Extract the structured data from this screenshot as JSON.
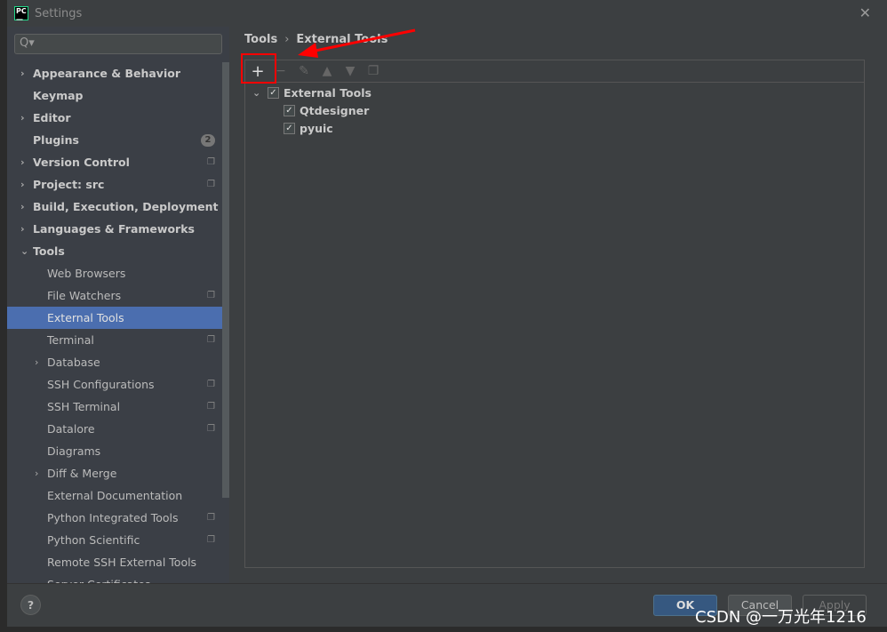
{
  "window": {
    "title": "Settings",
    "logo": "PC"
  },
  "search": {
    "placeholder": "Q▾"
  },
  "sidebar": {
    "items": [
      {
        "label": "Appearance & Behavior",
        "level": 0,
        "arrow": "›",
        "bold": true
      },
      {
        "label": "Keymap",
        "level": 0,
        "bold": true
      },
      {
        "label": "Editor",
        "level": 0,
        "arrow": "›",
        "bold": true
      },
      {
        "label": "Plugins",
        "level": 0,
        "bold": true,
        "badge": "2"
      },
      {
        "label": "Version Control",
        "level": 0,
        "arrow": "›",
        "bold": true,
        "copy": true
      },
      {
        "label": "Project: src",
        "level": 0,
        "arrow": "›",
        "bold": true,
        "copy": true
      },
      {
        "label": "Build, Execution, Deployment",
        "level": 0,
        "arrow": "›",
        "bold": true
      },
      {
        "label": "Languages & Frameworks",
        "level": 0,
        "arrow": "›",
        "bold": true
      },
      {
        "label": "Tools",
        "level": 0,
        "arrow": "⌄",
        "bold": true
      },
      {
        "label": "Web Browsers",
        "level": 1
      },
      {
        "label": "File Watchers",
        "level": 1,
        "copy": true
      },
      {
        "label": "External Tools",
        "level": 1,
        "selected": true
      },
      {
        "label": "Terminal",
        "level": 1,
        "copy": true
      },
      {
        "label": "Database",
        "level": 1,
        "arrow": "›"
      },
      {
        "label": "SSH Configurations",
        "level": 1,
        "copy": true
      },
      {
        "label": "SSH Terminal",
        "level": 1,
        "copy": true
      },
      {
        "label": "Datalore",
        "level": 1,
        "copy": true
      },
      {
        "label": "Diagrams",
        "level": 1
      },
      {
        "label": "Diff & Merge",
        "level": 1,
        "arrow": "›"
      },
      {
        "label": "External Documentation",
        "level": 1
      },
      {
        "label": "Python Integrated Tools",
        "level": 1,
        "copy": true
      },
      {
        "label": "Python Scientific",
        "level": 1,
        "copy": true
      },
      {
        "label": "Remote SSH External Tools",
        "level": 1
      },
      {
        "label": "Server Certificates",
        "level": 1
      }
    ]
  },
  "breadcrumb": {
    "parent": "Tools",
    "separator": "›",
    "current": "External Tools"
  },
  "toolbar": {
    "add": "+",
    "remove": "−",
    "edit": "✎",
    "up": "▲",
    "down": "▼",
    "copy": "❐"
  },
  "tree": {
    "group": "External Tools",
    "items": [
      "Qtdesigner",
      "pyuic"
    ]
  },
  "footer": {
    "help": "?",
    "ok": "OK",
    "cancel": "Cancel",
    "apply": "Apply"
  },
  "watermark": "CSDN @一万光年1216",
  "colors": {
    "selection": "#4b6eaf",
    "annotation": "#ff0000"
  }
}
